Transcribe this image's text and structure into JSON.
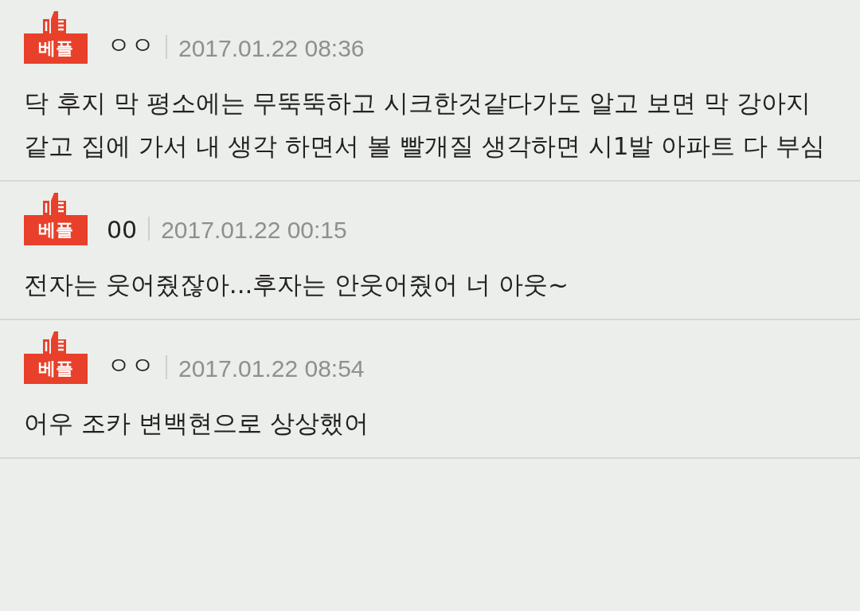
{
  "comments": [
    {
      "badge": "베플",
      "author": "ㅇㅇ",
      "time": "2017.01.22 08:36",
      "text": "닥 후지 막 평소에는 무뚝뚝하고 시크한것같다가도 알고 보면 막 강아지 같고 집에 가서 내 생각 하면서 볼 빨개질 생각하면 시1발 아파트 다 부심"
    },
    {
      "badge": "베플",
      "author": "00",
      "time": "2017.01.22 00:15",
      "text": "전자는 웃어줬잖아...후자는 안웃어줬어 너 아웃~"
    },
    {
      "badge": "베플",
      "author": "ㅇㅇ",
      "time": "2017.01.22 08:54",
      "text": "어우 조카 변백현으로 상상했어"
    }
  ]
}
